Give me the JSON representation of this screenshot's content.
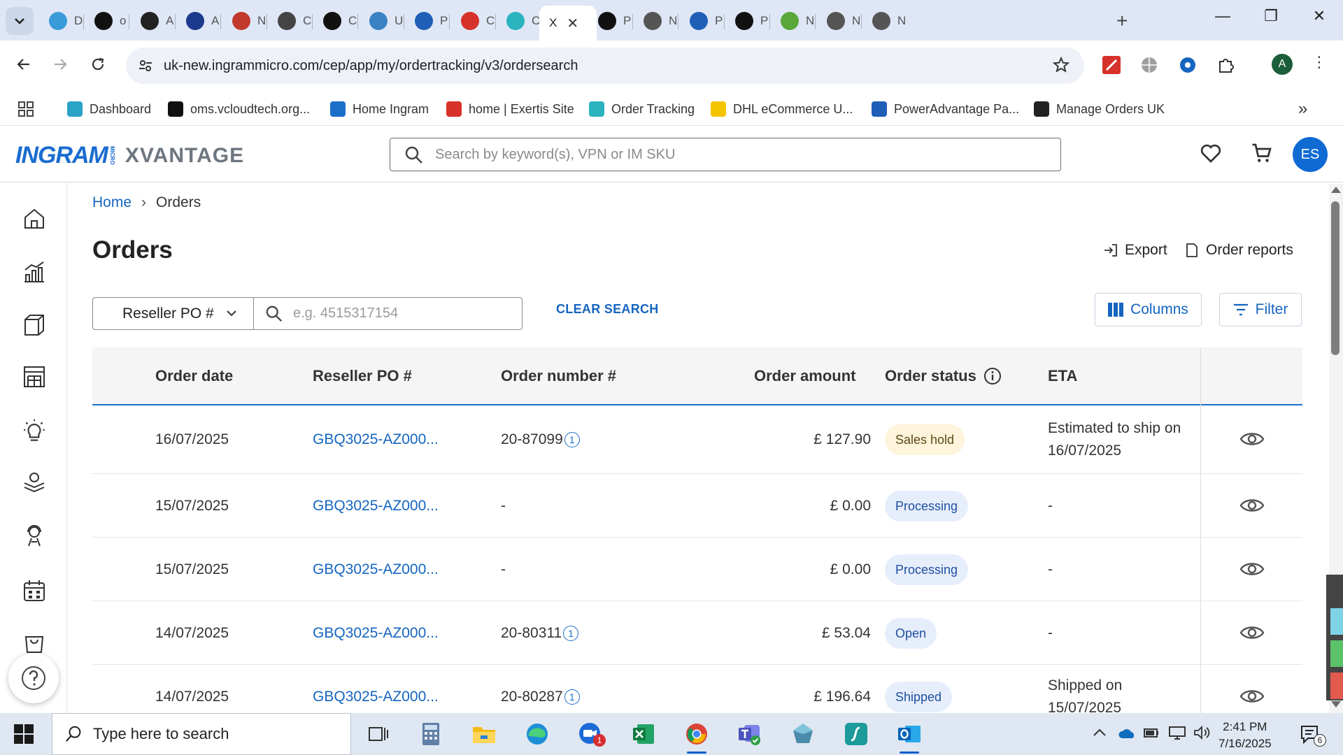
{
  "browser": {
    "tabs": [
      {
        "label": "D",
        "color": "#3a9bd9"
      },
      {
        "label": "o",
        "color": "#111111"
      },
      {
        "label": "A",
        "color": "#222222"
      },
      {
        "label": "A",
        "color": "#1b3a8c"
      },
      {
        "label": "N",
        "color": "#c0392b"
      },
      {
        "label": "C",
        "color": "#444444"
      },
      {
        "label": "C",
        "color": "#111111"
      },
      {
        "label": "U",
        "color": "#3b82c4"
      },
      {
        "label": "P",
        "color": "#1f5fb8"
      },
      {
        "label": "C",
        "color": "#d6312a"
      },
      {
        "label": "C",
        "color": "#2bb3c0"
      },
      {
        "label": "X",
        "color": "#ffffff"
      },
      {
        "label": "P",
        "color": "#111111"
      },
      {
        "label": "N",
        "color": "#555555"
      },
      {
        "label": "P",
        "color": "#1f5fb8"
      },
      {
        "label": "P",
        "color": "#111111"
      },
      {
        "label": "N",
        "color": "#5aa83a"
      },
      {
        "label": "N",
        "color": "#555555"
      },
      {
        "label": "N",
        "color": "#555555"
      }
    ],
    "url": "uk-new.ingrammicro.com/cep/app/my/ordertracking/v3/ordersearch",
    "profile_initial": "A",
    "bookmarks": [
      {
        "label": "Dashboard",
        "color": "#2aa3c6"
      },
      {
        "label": "oms.vcloudtech.org...",
        "color": "#111111"
      },
      {
        "label": "Home Ingram",
        "color": "#1c6fc9"
      },
      {
        "label": "home | Exertis Site",
        "color": "#d6312a"
      },
      {
        "label": "Order Tracking",
        "color": "#2bb3c0"
      },
      {
        "label": "DHL eCommerce U...",
        "color": "#f5c400"
      },
      {
        "label": "PowerAdvantage Pa...",
        "color": "#1f5fb8"
      },
      {
        "label": "Manage Orders UK",
        "color": "#222222"
      }
    ]
  },
  "app": {
    "logo_ingram": "INGRAM",
    "logo_micro": "MICRO",
    "logo_xvantage": "XVANTAGE",
    "search_placeholder": "Search by keyword(s), VPN or IM SKU",
    "user_initials": "ES",
    "accent": "#1565c0"
  },
  "breadcrumb": {
    "home": "Home",
    "current": "Orders"
  },
  "page": {
    "title": "Orders",
    "export_label": "Export",
    "reports_label": "Order reports",
    "filter_field": "Reseller PO #",
    "filter_placeholder": "e.g. 4515317154",
    "clear_search": "CLEAR SEARCH",
    "columns_label": "Columns",
    "filter_label": "Filter"
  },
  "table": {
    "headers": {
      "date": "Order date",
      "po": "Reseller PO #",
      "number": "Order number #",
      "amount": "Order amount",
      "status": "Order status",
      "eta": "ETA"
    },
    "rows": [
      {
        "date": "16/07/2025",
        "po": "GBQ3025-AZ000...",
        "number": "20-87099",
        "has_info": true,
        "amount": "£ 127.90",
        "status": "Sales hold",
        "status_kind": "hold",
        "eta_line1": "Estimated to ship on",
        "eta_line2": "16/07/2025"
      },
      {
        "date": "15/07/2025",
        "po": "GBQ3025-AZ000...",
        "number": "-",
        "has_info": false,
        "amount": "£ 0.00",
        "status": "Processing",
        "status_kind": "proc",
        "eta_line1": "-",
        "eta_line2": ""
      },
      {
        "date": "15/07/2025",
        "po": "GBQ3025-AZ000...",
        "number": "-",
        "has_info": false,
        "amount": "£ 0.00",
        "status": "Processing",
        "status_kind": "proc",
        "eta_line1": "-",
        "eta_line2": ""
      },
      {
        "date": "14/07/2025",
        "po": "GBQ3025-AZ000...",
        "number": "20-80311",
        "has_info": true,
        "amount": "£ 53.04",
        "status": "Open",
        "status_kind": "proc",
        "eta_line1": "-",
        "eta_line2": ""
      },
      {
        "date": "14/07/2025",
        "po": "GBQ3025-AZ000...",
        "number": "20-80287",
        "has_info": true,
        "amount": "£ 196.64",
        "status": "Shipped",
        "status_kind": "proc",
        "eta_line1": "Shipped on",
        "eta_line2": "15/07/2025"
      }
    ]
  },
  "taskbar": {
    "search_text": "Type here to search",
    "time": "2:41 PM",
    "date": "7/16/2025",
    "notification_count": "6",
    "zoom_badge": "1"
  }
}
